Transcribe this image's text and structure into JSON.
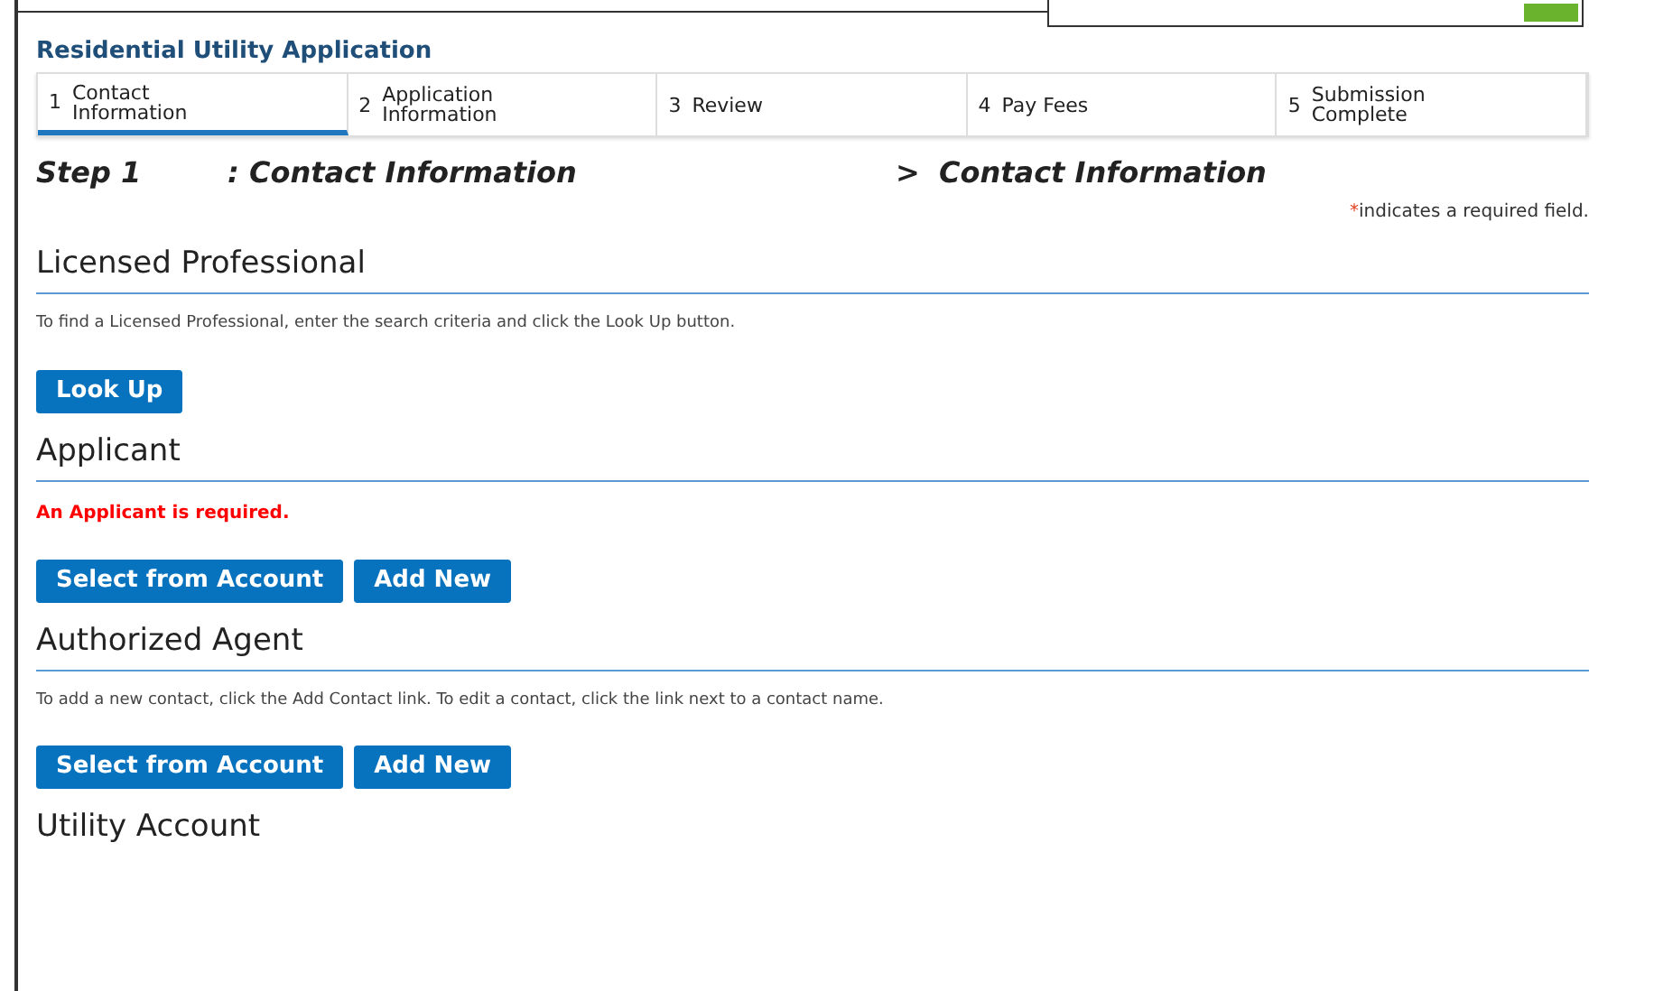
{
  "title": "Residential Utility Application",
  "tabs": [
    {
      "number": "1",
      "label": "Contact Information",
      "selected": true
    },
    {
      "number": "2",
      "label": "Application Information",
      "selected": false
    },
    {
      "number": "3",
      "label": "Review",
      "selected": false
    },
    {
      "number": "4",
      "label": "Pay Fees",
      "selected": false
    },
    {
      "number": "5",
      "label": "Submission Complete",
      "selected": false
    }
  ],
  "step": {
    "label": "Step 1",
    "page": ": Contact Information",
    "separator": ">",
    "section": "Contact Information"
  },
  "required_note": {
    "mark": "*",
    "text": "indicates a required field."
  },
  "sections": [
    {
      "title": "Licensed Professional",
      "message": {
        "kind": "note",
        "text": "To find a Licensed Professional, enter the search criteria and click the Look Up button."
      },
      "buttons": [
        "Look Up"
      ]
    },
    {
      "title": "Applicant",
      "message": {
        "kind": "error",
        "text": "An Applicant is required."
      },
      "buttons": [
        "Select from Account",
        "Add New"
      ]
    },
    {
      "title": "Authorized Agent",
      "message": {
        "kind": "note",
        "text": "To add a new contact, click the Add Contact link. To edit a contact, click the link next to a contact name."
      },
      "buttons": [
        "Select from Account",
        "Add New"
      ]
    },
    {
      "title": "Utility Account"
    }
  ]
}
